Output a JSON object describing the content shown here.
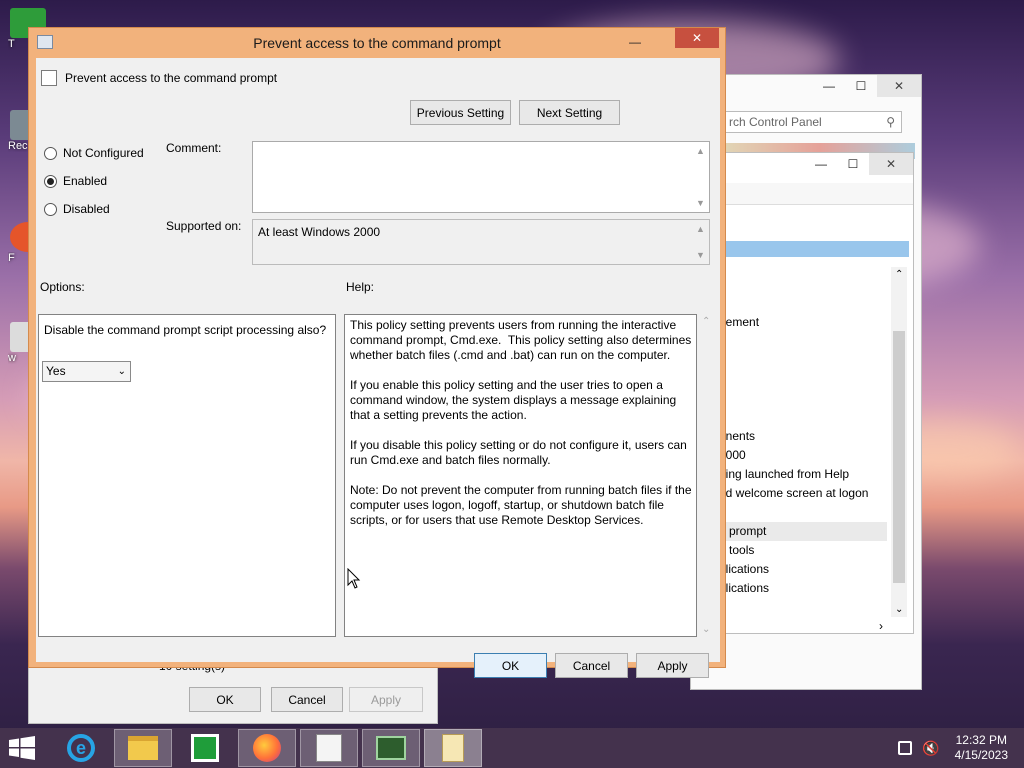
{
  "dialog": {
    "title": "Prevent access to the command prompt",
    "policy_name": "Prevent access to the command prompt",
    "previous_setting": "Previous Setting",
    "next_setting": "Next Setting",
    "state_options": [
      "Not Configured",
      "Enabled",
      "Disabled"
    ],
    "selected_state": "Enabled",
    "comment_label": "Comment:",
    "comment_value": "",
    "supported_label": "Supported on:",
    "supported_value": "At least Windows 2000",
    "options_label": "Options:",
    "help_label": "Help:",
    "option_question": "Disable the command prompt script processing also?",
    "option_value": "Yes",
    "help_text": "This policy setting prevents users from running the interactive command prompt, Cmd.exe.  This policy setting also determines whether batch files (.cmd and .bat) can run on the computer.\n\nIf you enable this policy setting and the user tries to open a command window, the system displays a message explaining that a setting prevents the action.\n\nIf you disable this policy setting or do not configure it, users can run Cmd.exe and batch files normally.\n\nNote: Do not prevent the computer from running batch files if the computer uses logon, logoff, startup, or shutdown batch file scripts, or for users that use Remote Desktop Services.",
    "ok": "OK",
    "cancel": "Cancel",
    "apply": "Apply"
  },
  "control_panel": {
    "search_placeholder": "rch Control Panel"
  },
  "gp_editor": {
    "items": [
      "gement",
      "onents",
      "2000",
      "eing launched from Help",
      "ed welcome screen at logon",
      "d prompt",
      "g tools",
      "plications",
      "plications"
    ],
    "selected_item": "d prompt",
    "status": "10 setting(s)"
  },
  "back_dialog": {
    "ok": "OK",
    "cancel": "Cancel",
    "apply": "Apply"
  },
  "desktop_icons": [
    "T",
    "Rec",
    "F",
    "w"
  ],
  "taskbar": {
    "apps": [
      "ie-icon",
      "file-explorer-icon",
      "store-icon",
      "firefox-icon",
      "notepad-icon",
      "task-manager-icon",
      "notes-icon"
    ],
    "time": "12:32 PM",
    "date": "4/15/2023"
  },
  "colors": {
    "dialog_frame": "#f2b27c",
    "close_button": "#c7503f",
    "selection": "#cde6f7"
  }
}
